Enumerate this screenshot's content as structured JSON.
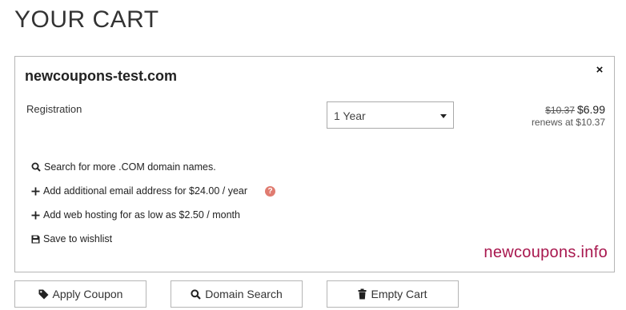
{
  "page": {
    "title": "YOUR CART"
  },
  "cart": {
    "domain": "newcoupons-test.com",
    "close_icon": "×",
    "registration_label": "Registration",
    "term_selected": "1 Year",
    "price_old": "$10.37",
    "price_new": "$6.99",
    "renews_text": "renews at $10.37",
    "actions": [
      {
        "icon": "search-icon",
        "label": "Search for more .COM domain names."
      },
      {
        "icon": "plus-icon",
        "label": "Add additional email address for $24.00 / year"
      },
      {
        "icon": "plus-icon",
        "label": "Add web hosting for as low as $2.50 / month"
      },
      {
        "icon": "save-icon",
        "label": "Save to wishlist"
      }
    ],
    "help_icon": "?",
    "watermark": "newcoupons.info"
  },
  "buttons": {
    "apply_coupon": "Apply Coupon",
    "domain_search": "Domain Search",
    "empty_cart": "Empty Cart"
  },
  "colors": {
    "help_icon": "#e07b70",
    "watermark": "#a8174e",
    "border": "#b5b5b5"
  }
}
